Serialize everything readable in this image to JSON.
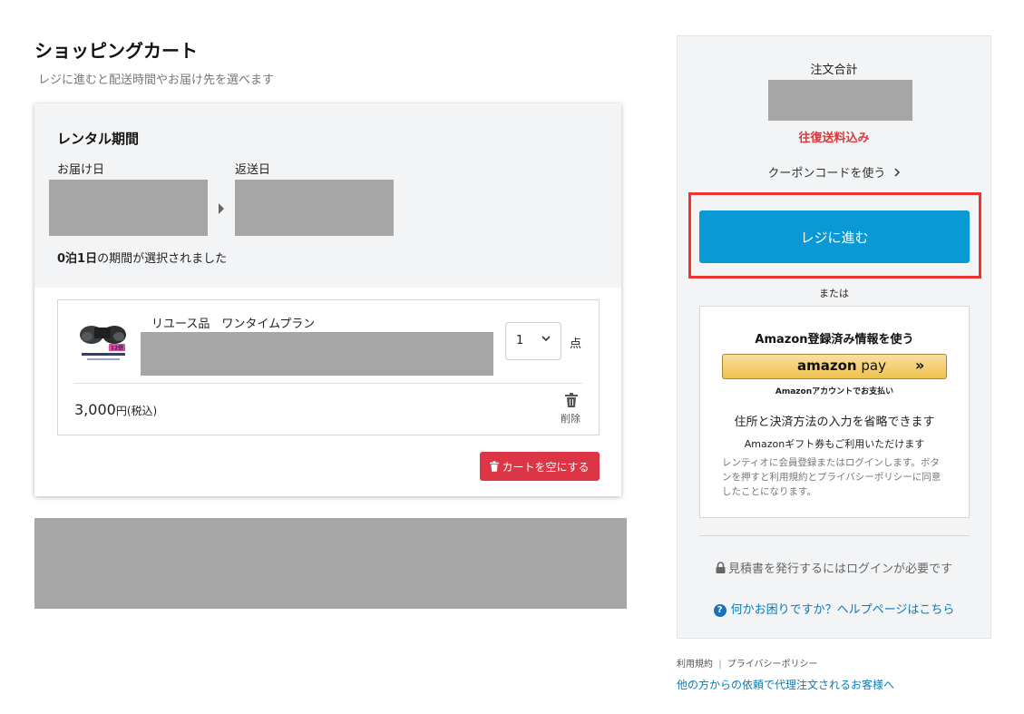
{
  "header": {
    "title": "ショッピングカート",
    "subtitle": "レジに進むと配送時間やお届け先を選べます"
  },
  "rental": {
    "title": "レンタル期間",
    "delivery_label": "お届け日",
    "return_label": "返送日",
    "period_bold": "0泊1日",
    "period_rest": "の期間が選択されました"
  },
  "item": {
    "name": "リユース品　ワンタイムプラン",
    "quantity": "1",
    "unit": "点",
    "price": "3,000",
    "price_suffix": "円",
    "tax_note": "(税込)",
    "delete_label": "削除",
    "thumb_badge": "12倍"
  },
  "cart": {
    "empty_label": "カートを空にする"
  },
  "summary": {
    "total_label": "注文合計",
    "shipping_note": "往復送料込み",
    "coupon_label": "クーポンコードを使う",
    "checkout_label": "レジに進む",
    "or_label": "または"
  },
  "amazon": {
    "heading": "Amazon登録済み情報を使う",
    "pay_logo_a": "amazon",
    "pay_logo_b": "pay",
    "sub": "Amazonアカウントでお支払い",
    "line1": "住所と決済方法の入力を省略できます",
    "line2": "Amazonギフト券もご利用いただけます",
    "note": "レンティオに会員登録またはログインします。ボタンを押すと利用規約とプライバシーポリシーに同意したことになります。"
  },
  "notice": {
    "estimate": "見積書を発行するにはログインが必要です",
    "help": "何かお困りですか？ヘルプページはこちら"
  },
  "footer": {
    "terms": "利用規約",
    "separator": "|",
    "privacy": "プライバシーポリシー",
    "proxy": "他の方からの依頼で代理注文されるお客様へ"
  },
  "colors": {
    "accent": "#0a99d5",
    "danger": "#dc3545",
    "highlight": "#ee3333"
  },
  "icons": [
    "trash-icon",
    "chevron-down-icon",
    "chevron-right-icon",
    "lock-icon",
    "help-icon",
    "arrow-right-icon"
  ]
}
